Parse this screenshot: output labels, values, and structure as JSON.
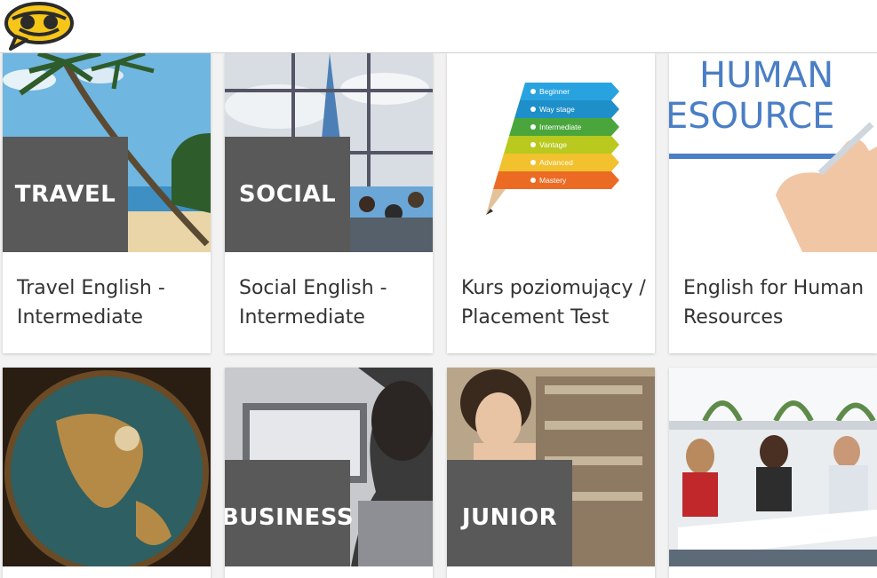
{
  "colors": {
    "accent_yellow": "#f5c518",
    "badge_gray": "#595959",
    "title_text": "#333333"
  },
  "header": {
    "logo_icon": "speech-bubble-smile-logo"
  },
  "courses": [
    {
      "badge": "TRAVEL",
      "title": "Travel English - Intermediate"
    },
    {
      "badge": "SOCIAL",
      "title": "Social English - Intermediate"
    },
    {
      "badge": "",
      "title": "Kurs poziomujący / Placement Test",
      "levels": [
        "Beginner",
        "Way stage",
        "Intermediate",
        "Vantage",
        "Advanced",
        "Mastery"
      ]
    },
    {
      "badge": "",
      "title": "English for Human Resources",
      "image_text": [
        "HUMAN",
        "ESOURCE"
      ]
    },
    {
      "badge": "",
      "title": ""
    },
    {
      "badge": "BUSINESS",
      "title": ""
    },
    {
      "badge": "JUNIOR",
      "title": ""
    },
    {
      "badge": "",
      "title": ""
    }
  ]
}
